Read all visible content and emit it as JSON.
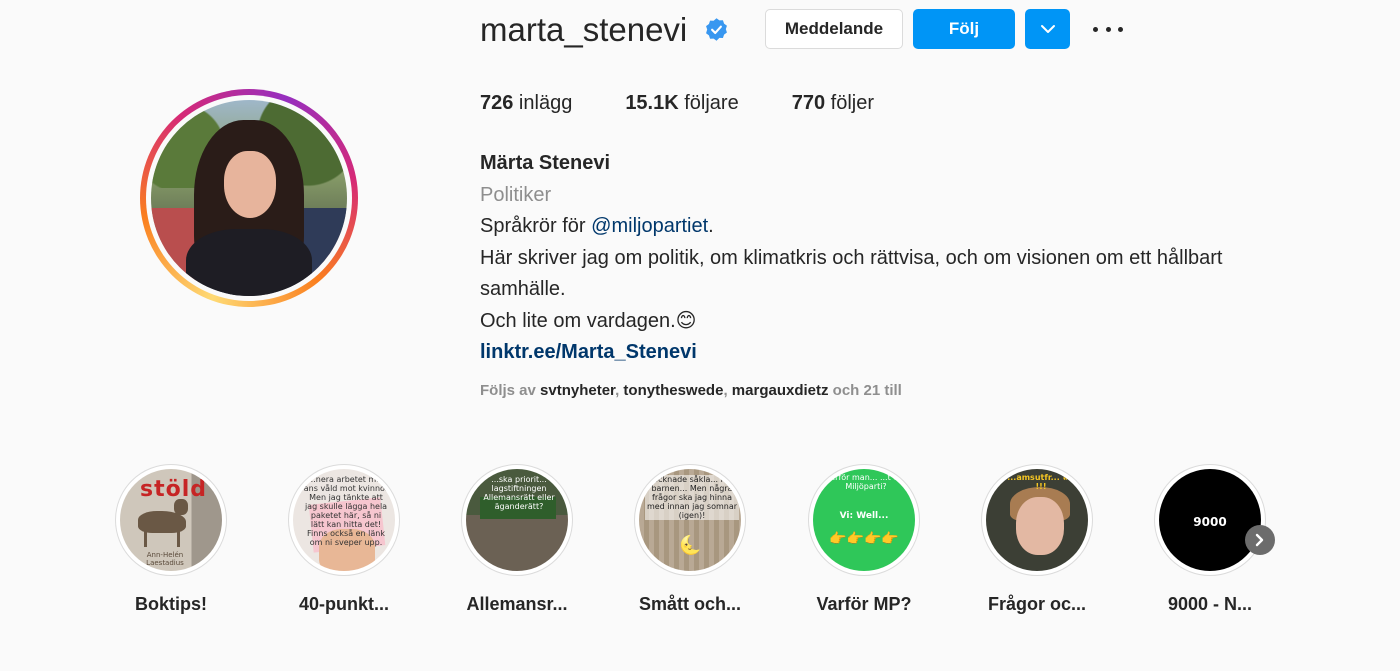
{
  "profile": {
    "username": "marta_stenevi",
    "verified": true,
    "full_name": "Märta Stenevi",
    "category": "Politiker",
    "bio_line1_prefix": "Språkrör för ",
    "bio_mention": "@miljopartiet",
    "bio_line1_suffix": ".",
    "bio_line2": "Här skriver jag om politik, om klimatkris och rättvisa, och om visionen om ett hållbart samhälle.",
    "bio_line3": "Och lite om vardagen.😊",
    "link": "linktr.ee/Marta_Stenevi"
  },
  "actions": {
    "message_label": "Meddelande",
    "follow_label": "Följ"
  },
  "stats": {
    "posts_count": "726",
    "posts_label": " inlägg",
    "followers_count": "15.1K",
    "followers_label": " följare",
    "following_count": "770",
    "following_label": " följer"
  },
  "followed_by": {
    "prefix": "Följs av ",
    "accounts": [
      "svtnyheter",
      "tonytheswede",
      "margauxdietz"
    ],
    "separator": ", ",
    "suffix": " och 21 till"
  },
  "highlights": [
    {
      "label": "Boktips!",
      "cover_text": "stöld",
      "cover_text2": "Ann-Helén Laestadius"
    },
    {
      "label": "40-punkt...",
      "cover_text": "...nera arbetet m... ans våld mot kvinnor Men jag tänkte att jag skulle lägga hela paketet här, så ni lätt kan hitta det! Finns också en länk om ni sveper upp."
    },
    {
      "label": "Allemansr...",
      "cover_text": "...ska priorit... lagstiftningen Allemansrätt eller äganderätt?"
    },
    {
      "label": "Smått och...",
      "cover_text": "...ocknade såkla... med barnen... Men några frågor ska jag hinna med innan jag somnar (igen)!"
    },
    {
      "label": "Varför MP?",
      "cover_text": "...rför man... ...t ett Miljöparti?",
      "cover_text2": "Vi: Well...",
      "cover_emoji": "👉👉👉👉"
    },
    {
      "label": "Frågor oc...",
      "cover_text": "...amsutfr... #2 !!!"
    },
    {
      "label": "9000 - N...",
      "cover_text": "9000"
    }
  ],
  "colors": {
    "primary_blue": "#0095f6",
    "link_blue": "#00376b",
    "text": "#262626",
    "secondary_text": "#8e8e8e",
    "background": "#fafafa"
  },
  "icons": {
    "verified": "verified-badge-icon",
    "dropdown": "chevron-down-icon",
    "more": "more-options-icon",
    "next": "chevron-right-icon"
  }
}
